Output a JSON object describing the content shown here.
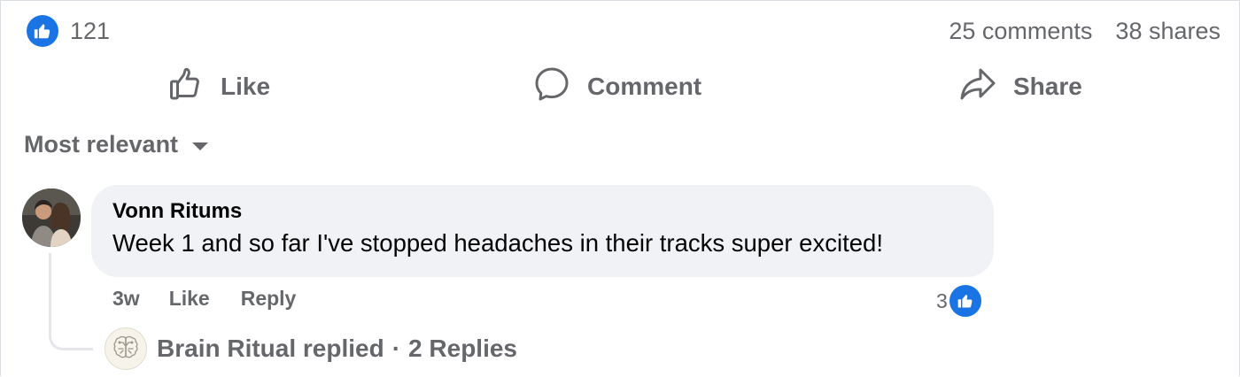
{
  "summary": {
    "reaction_count": "121",
    "comments": "25 comments",
    "shares": "38 shares"
  },
  "actions": {
    "like_label": "Like",
    "comment_label": "Comment",
    "share_label": "Share"
  },
  "sort": {
    "label": "Most relevant"
  },
  "comment": {
    "author": "Vonn Ritums",
    "text": "Week 1 and so far I've stopped headaches in their tracks super excited!",
    "time": "3w",
    "like_label": "Like",
    "reply_label": "Reply",
    "reaction_count": "3"
  },
  "replies": {
    "summary": "Brain Ritual replied",
    "separator": "·",
    "count": "2 Replies"
  },
  "colors": {
    "accent": "#1b74e4",
    "text_secondary": "#65676b",
    "bubble": "#f0f2f5"
  },
  "icons": [
    "like-badge-icon",
    "thumbs-up-outline-icon",
    "speech-bubble-icon",
    "share-arrow-icon",
    "caret-down-icon",
    "brain-logo-icon"
  ]
}
